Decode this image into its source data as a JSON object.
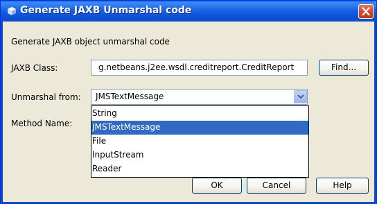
{
  "window": {
    "title": "Generate JAXB Unmarshal code"
  },
  "dialog": {
    "description": "Generate JAXB object unmarshal code",
    "jaxb_class_label": "JAXB Class:",
    "jaxb_class_value": "g.netbeans.j2ee.wsdl.creditreport.CreditReport",
    "find_button": "Find...",
    "unmarshal_from_label": "Unmarshal from:",
    "unmarshal_from_selected": "JMSTextMessage",
    "method_name_label": "Method Name:",
    "dropdown_options": [
      "String",
      "JMSTextMessage",
      "File",
      "InputStream",
      "Reader"
    ],
    "ok_button": "OK",
    "cancel_button": "Cancel",
    "help_button": "Help"
  },
  "colors": {
    "title_bar": "#0a4bc9",
    "selection": "#316ac5",
    "dialog_bg": "#ece9d8"
  },
  "icons": {
    "title": "netbeans-cube-icon",
    "close": "close-x-icon",
    "combo": "chevron-down-icon"
  }
}
